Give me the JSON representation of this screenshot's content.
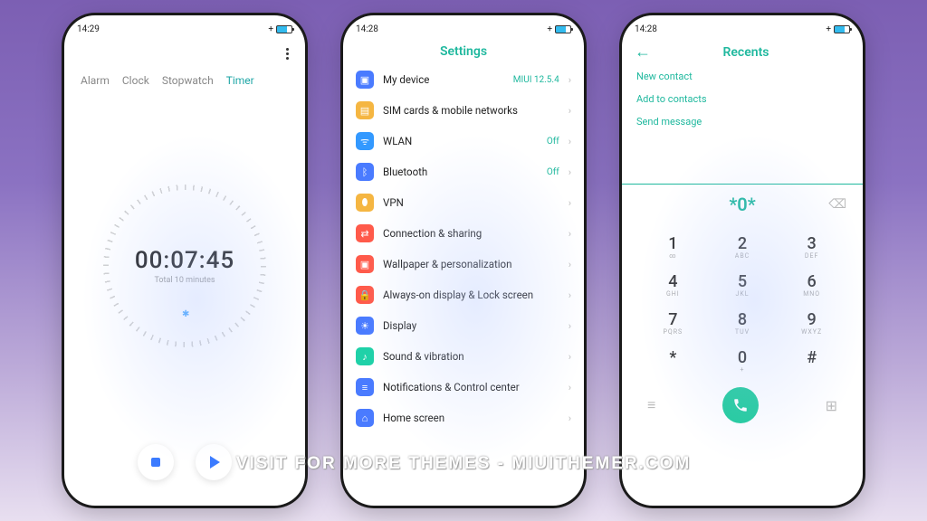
{
  "statusbar": {
    "time_p1": "14:29",
    "time_p2": "14:28",
    "time_p3": "14:28",
    "plus": "+"
  },
  "phone1": {
    "tabs": [
      {
        "label": "Alarm"
      },
      {
        "label": "Clock"
      },
      {
        "label": "Stopwatch"
      },
      {
        "label": "Timer"
      }
    ],
    "active_tab": 3,
    "time": "00:07:45",
    "subtitle": "Total 10 minutes"
  },
  "phone2": {
    "title": "Settings",
    "items": [
      {
        "icon_color": "#4a7bff",
        "glyph": "▣",
        "label": "My device",
        "value": "MIUI 12.5.4",
        "value_color": "#1fb89e"
      },
      {
        "icon_color": "#f5b642",
        "glyph": "▤",
        "label": "SIM cards & mobile networks",
        "value": ""
      },
      {
        "icon_color": "#3399ff",
        "glyph": "ᯤ",
        "label": "WLAN",
        "value": "Off",
        "value_color": "#1fb89e"
      },
      {
        "icon_color": "#4a7bff",
        "glyph": "ᛒ",
        "label": "Bluetooth",
        "value": "Off",
        "value_color": "#1fb89e"
      },
      {
        "icon_color": "#f5b642",
        "glyph": "⬮",
        "label": "VPN",
        "value": ""
      },
      {
        "icon_color": "#ff5a4a",
        "glyph": "⇄",
        "label": "Connection & sharing",
        "value": ""
      },
      {
        "icon_color": "#ff5a4a",
        "glyph": "▣",
        "label": "Wallpaper & personalization",
        "value": ""
      },
      {
        "icon_color": "#ff5a4a",
        "glyph": "🔒",
        "label": "Always-on display & Lock screen",
        "value": ""
      },
      {
        "icon_color": "#4a7bff",
        "glyph": "☀",
        "label": "Display",
        "value": ""
      },
      {
        "icon_color": "#1fd1a8",
        "glyph": "♪",
        "label": "Sound & vibration",
        "value": ""
      },
      {
        "icon_color": "#4a7bff",
        "glyph": "≡",
        "label": "Notifications & Control center",
        "value": ""
      },
      {
        "icon_color": "#4a7bff",
        "glyph": "⌂",
        "label": "Home screen",
        "value": ""
      }
    ]
  },
  "phone3": {
    "title": "Recents",
    "actions": [
      {
        "label": "New contact"
      },
      {
        "label": "Add to contacts"
      },
      {
        "label": "Send message"
      }
    ],
    "input": "*0*",
    "keys": [
      {
        "d": "1",
        "l": "∞"
      },
      {
        "d": "2",
        "l": "ABC"
      },
      {
        "d": "3",
        "l": "DEF"
      },
      {
        "d": "4",
        "l": "GHI"
      },
      {
        "d": "5",
        "l": "JKL"
      },
      {
        "d": "6",
        "l": "MNO"
      },
      {
        "d": "7",
        "l": "PQRS"
      },
      {
        "d": "8",
        "l": "TUV"
      },
      {
        "d": "9",
        "l": "WXYZ"
      },
      {
        "d": "*",
        "l": ""
      },
      {
        "d": "0",
        "l": "+"
      },
      {
        "d": "#",
        "l": ""
      }
    ]
  },
  "watermark": "VISIT FOR MORE THEMES - MIUITHEMER.COM"
}
